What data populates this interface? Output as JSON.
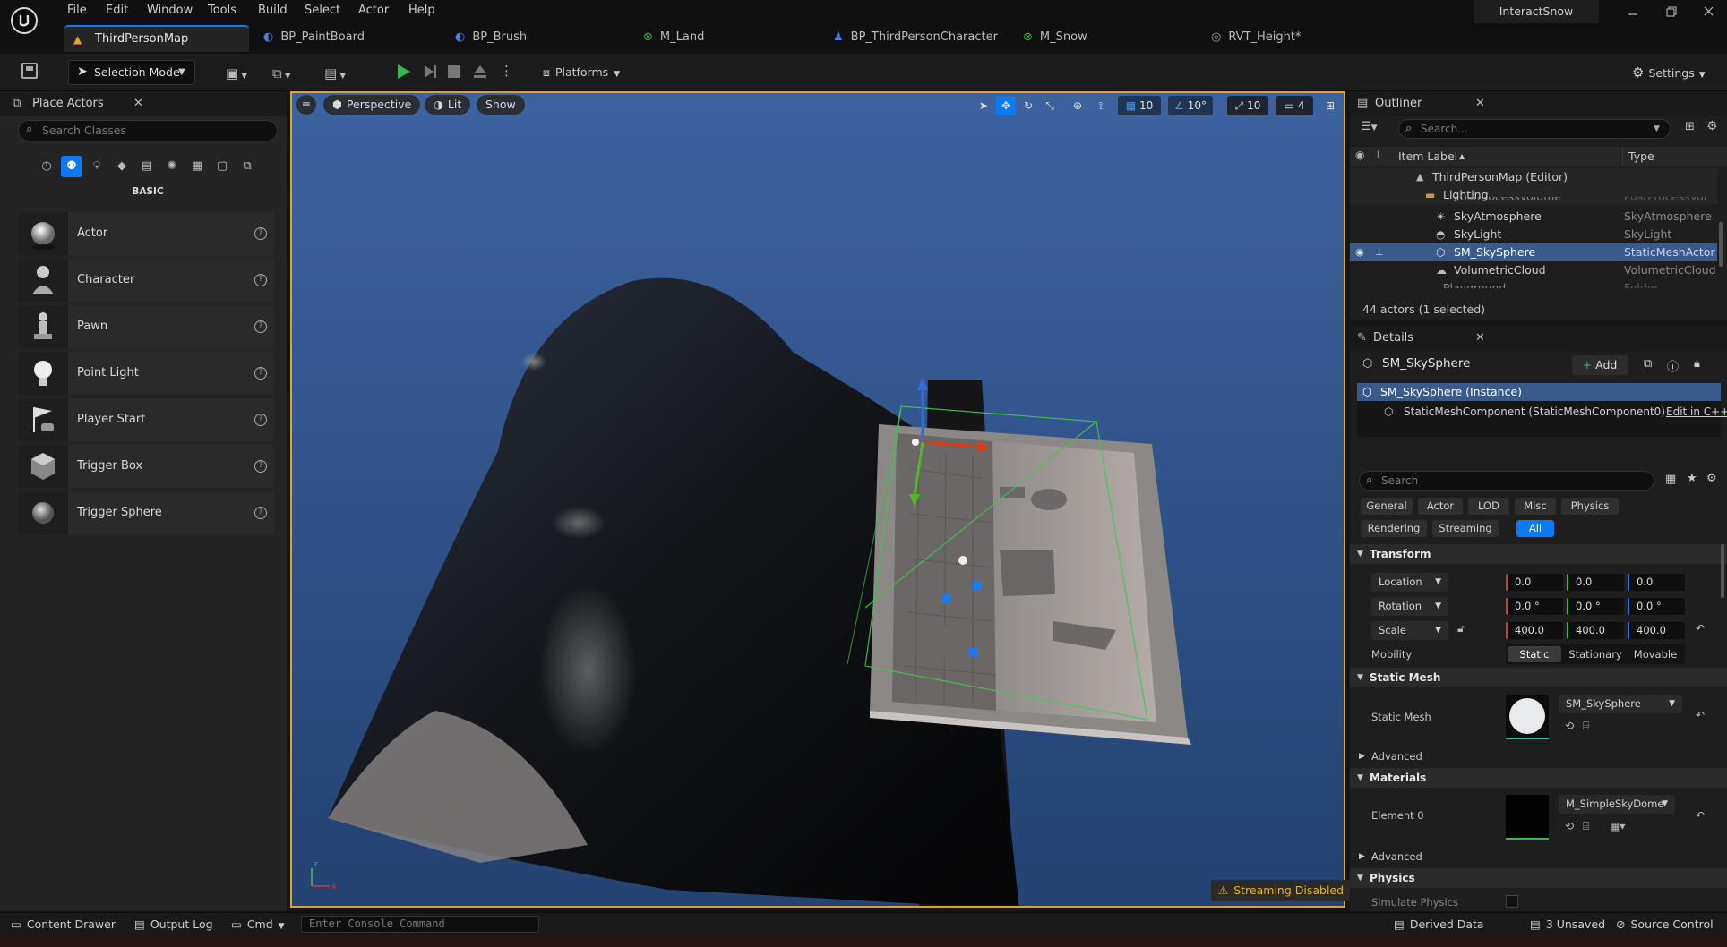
{
  "menu": {
    "file": "File",
    "edit": "Edit",
    "window": "Window",
    "tools": "Tools",
    "build": "Build",
    "select": "Select",
    "actor": "Actor",
    "help": "Help"
  },
  "project_name": "InteractSnow",
  "tabs": [
    {
      "label": "ThirdPersonMap"
    },
    {
      "label": "BP_PaintBoard"
    },
    {
      "label": "BP_Brush"
    },
    {
      "label": "M_Land"
    },
    {
      "label": "BP_ThirdPersonCharacter"
    },
    {
      "label": "M_Snow"
    },
    {
      "label": "RVT_Height*"
    }
  ],
  "toolbar": {
    "selection_mode": "Selection Mode",
    "platforms": "Platforms",
    "settings": "Settings"
  },
  "place_actors": {
    "title": "Place Actors",
    "search_placeholder": "Search Classes",
    "category": "BASIC",
    "items": [
      {
        "label": "Actor"
      },
      {
        "label": "Character"
      },
      {
        "label": "Pawn"
      },
      {
        "label": "Point Light"
      },
      {
        "label": "Player Start"
      },
      {
        "label": "Trigger Box"
      },
      {
        "label": "Trigger Sphere"
      }
    ]
  },
  "viewport": {
    "perspective": "Perspective",
    "lit": "Lit",
    "show": "Show",
    "grid_snap": "10",
    "rot_snap": "10°",
    "scale_snap": "10",
    "cam_speed": "4",
    "streaming_warning": "Streaming Disabled"
  },
  "outliner": {
    "title": "Outliner",
    "search_placeholder": "Search...",
    "col_label": "Item Label",
    "col_type": "Type",
    "rows": [
      {
        "label": "ThirdPersonMap (Editor)",
        "type": ""
      },
      {
        "label": "Lighting",
        "type": ""
      },
      {
        "label": "PostProcessVolume",
        "type": "PostProcessVol"
      },
      {
        "label": "SkyAtmosphere",
        "type": "SkyAtmosphere"
      },
      {
        "label": "SkyLight",
        "type": "SkyLight"
      },
      {
        "label": "SM_SkySphere",
        "type": "StaticMeshActor"
      },
      {
        "label": "VolumetricCloud",
        "type": "VolumetricCloud"
      },
      {
        "label": "Playground",
        "type": "Folder"
      }
    ],
    "footer": "44 actors (1 selected)"
  },
  "details": {
    "title": "Details",
    "object_name": "SM_SkySphere",
    "add_label": "Add",
    "instance": "SM_SkySphere (Instance)",
    "component": "StaticMeshComponent (StaticMeshComponent0)",
    "edit_cpp": "Edit in C++",
    "search_placeholder": "Search",
    "filters": [
      "General",
      "Actor",
      "LOD",
      "Misc",
      "Physics",
      "Rendering",
      "Streaming",
      "All"
    ],
    "transform": {
      "section": "Transform",
      "location_label": "Location",
      "location": [
        "0.0",
        "0.0",
        "0.0"
      ],
      "rotation_label": "Rotation",
      "rotation": [
        "0.0 °",
        "0.0 °",
        "0.0 °"
      ],
      "scale_label": "Scale",
      "scale": [
        "400.0",
        "400.0",
        "400.0"
      ],
      "mobility_label": "Mobility",
      "mobility": [
        "Static",
        "Stationary",
        "Movable"
      ]
    },
    "static_mesh": {
      "section": "Static Mesh",
      "label": "Static Mesh",
      "value": "SM_SkySphere",
      "advanced": "Advanced"
    },
    "materials": {
      "section": "Materials",
      "label": "Element 0",
      "value": "M_SimpleSkyDome",
      "advanced": "Advanced"
    },
    "physics": {
      "section": "Physics",
      "simulate": "Simulate Physics"
    }
  },
  "status": {
    "content_drawer": "Content Drawer",
    "output_log": "Output Log",
    "cmd": "Cmd",
    "console_placeholder": "Enter Console Command",
    "derived_data": "Derived Data",
    "unsaved": "3 Unsaved",
    "source_control": "Source Control"
  },
  "colors": {
    "accent": "#0e7af2",
    "selection": "#3a5a8c",
    "viewport_sky": "#2e4e80",
    "warning": "#e8b320"
  }
}
